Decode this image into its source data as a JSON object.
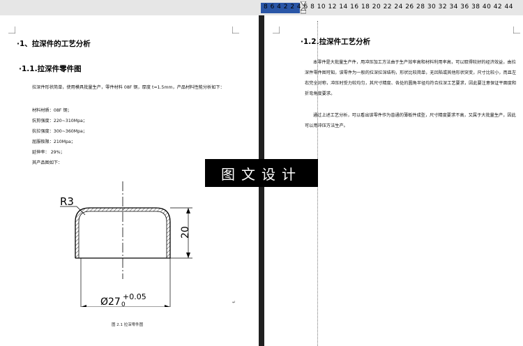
{
  "ruler": {
    "numbers": "8  6  4  2      2  4  6  8  10  12  14  16  18  20  22  24  26  28  30  32  34  36  38  40  42  44"
  },
  "left_page": {
    "heading1": "·1、拉深件的工艺分析",
    "heading2": "·1.1.拉深件零件图",
    "para1": "拉深件形状简单，使用模具批量生产，零件材料 08F 钢，厚度 t=1.5mm，产品材料性能分析如下：",
    "specs": [
      "材料材质：08F 钢；",
      "抗剪强度：220~310Mpa；",
      "抗拉强度：300~360Mpa；",
      "屈服极限：210Mpa；",
      "延伸率：   29%；",
      "其产品图如下："
    ],
    "drawing": {
      "radius_label": "R3",
      "height_label": "20",
      "dia_label": "Ø27",
      "tol_label": "+0.05",
      "tol_low": "0"
    },
    "caption": "图 2.1 拉深零件图"
  },
  "right_page": {
    "heading": "·1.2.拉深件工艺分析",
    "para1": "本零件是大批量生产件，用冲压加工方法由于生产效率高和材料利用率高，可以取得较好的经济效益，由拉深件零件图可知，该零件为一般的拉深拉深结构，形状比较简单，无凹陷或其他形状突变，尺寸比较小，而且左右完全对称，冲压时受力较均匀，其尺寸精度、各处的圆角半径均符合拉深工艺要求，因此要注意保证平面度和折弯角度要求。",
    "para2": "通过上述工艺分析，可以看出该零件作为普通的薄板件成型，尺寸精度要求不高，又属于大批量生产，因此可以用冲压方法生产。"
  },
  "watermark": "图文设计"
}
